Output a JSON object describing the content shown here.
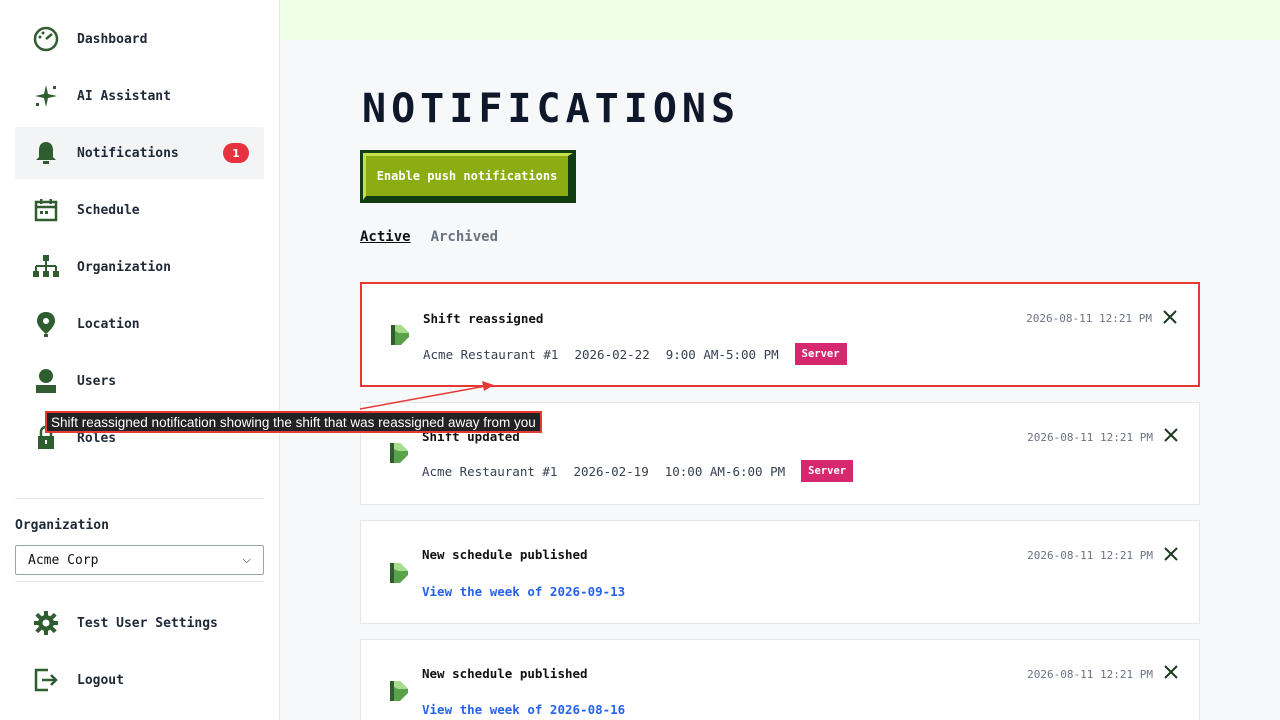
{
  "sidebar": {
    "items": [
      {
        "label": "Dashboard",
        "icon": "dashboard-icon"
      },
      {
        "label": "AI Assistant",
        "icon": "sparkle-icon"
      },
      {
        "label": "Notifications",
        "icon": "bell-icon",
        "badge": "1"
      },
      {
        "label": "Schedule",
        "icon": "calendar-icon"
      },
      {
        "label": "Organization",
        "icon": "org-chart-icon"
      },
      {
        "label": "Location",
        "icon": "location-pin-icon"
      },
      {
        "label": "Users",
        "icon": "user-icon"
      },
      {
        "label": "Roles",
        "icon": "lock-icon"
      }
    ],
    "org_label": "Organization",
    "org_selected": "Acme Corp",
    "bottom_items": [
      {
        "label": "Test User Settings",
        "icon": "gear-icon"
      },
      {
        "label": "Logout",
        "icon": "logout-icon"
      }
    ]
  },
  "main": {
    "title": "NOTIFICATIONS",
    "push_button": "Enable push notifications",
    "tabs": [
      {
        "label": "Active"
      },
      {
        "label": "Archived"
      }
    ],
    "notifications": [
      {
        "title": "Shift reassigned",
        "location": "Acme Restaurant #1",
        "date": "2026-02-22",
        "time_range": "9:00 AM-5:00 PM",
        "role": "Server",
        "timestamp": "2026-08-11 12:21 PM"
      },
      {
        "title": "Shift updated",
        "location": "Acme Restaurant #1",
        "date": "2026-02-19",
        "time_range": "10:00 AM-6:00 PM",
        "role": "Server",
        "timestamp": "2026-08-11 12:21 PM"
      },
      {
        "title": "New schedule published",
        "link": "View the week of 2026-09-13",
        "timestamp": "2026-08-11 12:21 PM"
      },
      {
        "title": "New schedule published",
        "link": "View the week of 2026-08-16",
        "timestamp": "2026-08-11 12:21 PM"
      }
    ]
  },
  "annotation": {
    "text": "Shift reassigned notification showing the shift that was reassigned away from you"
  },
  "colors": {
    "icon_green": "#2f5d2f",
    "bell_green": "#5aa24a",
    "button_green": "#8bad12",
    "role_pink": "#d6286e",
    "link_blue": "#2563eb",
    "highlight_red": "#e53935"
  }
}
